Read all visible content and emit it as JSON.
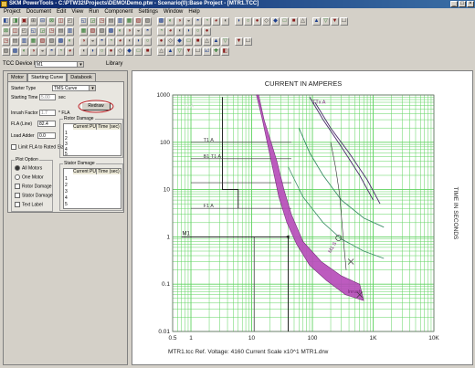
{
  "title": "SKM PowerTools - C:\\PTW32\\Projects\\DEMO\\Demo.ptw - Scenario(0):Base Project - [MTR1.TCC]",
  "menu": [
    "Project",
    "Document",
    "Edit",
    "View",
    "Run",
    "Component",
    "Settings",
    "Window",
    "Help"
  ],
  "library": {
    "label": "TCC Device List",
    "value": "M1",
    "library_label": "Library"
  },
  "tabs": [
    "Motor",
    "Starting Curve",
    "Databook"
  ],
  "starting": {
    "starter_type_label": "Starter Type",
    "starter_type": "TMS Curve",
    "starting_time_label": "Starting Time",
    "starting_time_value": "5.00",
    "starting_time_unit": "sec",
    "redraw": "Redraw",
    "inrush_label": "Inrush Factor",
    "inrush_value": "1.7",
    "inrush_unit": "* FLA",
    "fla_label": "FLA (Line)",
    "fla_value": "82.4",
    "load_adder_label": "Load Adder",
    "load_adder_value": "0.0",
    "limit_label": "Limit FLA to Rated Size",
    "rotor_title": "Rotor Damage",
    "stator_title": "Stator Damage",
    "col_current": "Current PU",
    "col_time": "Time (sec)",
    "rows": [
      "1",
      "2",
      "3",
      "4",
      "5"
    ]
  },
  "plot_option": {
    "title": "Plot Option",
    "options": [
      "All Motors",
      "One Motor",
      "Rotor Damage",
      "Stator Damage",
      "Text Label"
    ]
  },
  "chart_data": {
    "type": "line",
    "title": "CURRENT IN AMPERES",
    "ylabel": "TIME IN SECONDS",
    "x_scale": "log",
    "y_scale": "log",
    "xlim": [
      0.5,
      10000
    ],
    "ylim": [
      0.01,
      1000
    ],
    "x_ticks": [
      "0.5",
      "1",
      "10",
      "100",
      "1K",
      "10K"
    ],
    "y_ticks": [
      "1000",
      "100",
      "10",
      "1",
      "0.1",
      "0.01"
    ],
    "grid": true,
    "labels": [
      "T1 A",
      "B1 T1 A",
      "F1 A",
      "M1",
      "TTx A",
      "M1 S",
      "Inrush"
    ],
    "footer": "MTR1.tcc   Ref. Voltage: 4160   Current Scale x10^1   MTR1.drw"
  }
}
